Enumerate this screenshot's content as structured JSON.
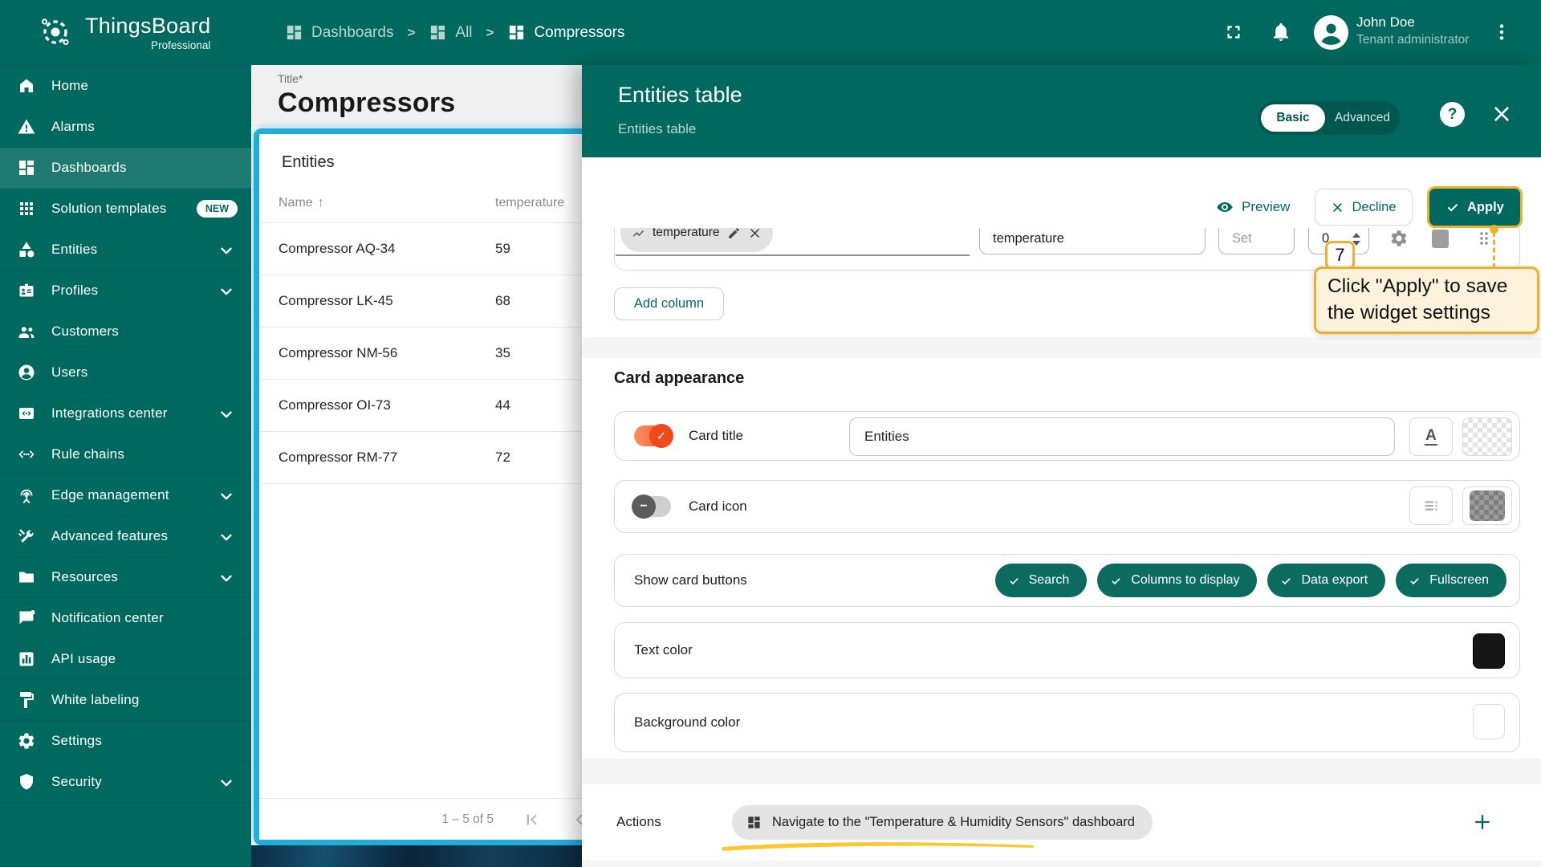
{
  "colors": {
    "accent": "#00695f",
    "selection_border": "#1faedc",
    "toggle_on": "#ee4a1c",
    "tour_accent": "#f0b02c",
    "tour_bg": "#fdf3dd",
    "pill_bg": "#0b6b5f"
  },
  "brand": {
    "name": "ThingsBoard",
    "edition": "Professional"
  },
  "topbar": {
    "breadcrumbs": [
      {
        "label": "Dashboards"
      },
      {
        "label": "All"
      },
      {
        "label": "Compressors"
      }
    ],
    "user": {
      "name": "John Doe",
      "role": "Tenant administrator"
    }
  },
  "sidebar": {
    "items": [
      {
        "label": "Home",
        "icon": "home"
      },
      {
        "label": "Alarms",
        "icon": "alarm"
      },
      {
        "label": "Dashboards",
        "icon": "dashboards",
        "active": true
      },
      {
        "label": "Solution templates",
        "icon": "apps",
        "badge": "NEW"
      },
      {
        "label": "Entities",
        "icon": "category",
        "expandable": true
      },
      {
        "label": "Profiles",
        "icon": "badge",
        "expandable": true
      },
      {
        "label": "Customers",
        "icon": "people"
      },
      {
        "label": "Users",
        "icon": "person"
      },
      {
        "label": "Integrations center",
        "icon": "integration",
        "expandable": true
      },
      {
        "label": "Rule chains",
        "icon": "ethernet"
      },
      {
        "label": "Edge management",
        "icon": "antenna",
        "expandable": true
      },
      {
        "label": "Advanced features",
        "icon": "tools",
        "expandable": true
      },
      {
        "label": "Resources",
        "icon": "folder",
        "expandable": true
      },
      {
        "label": "Notification center",
        "icon": "chat"
      },
      {
        "label": "API usage",
        "icon": "chart"
      },
      {
        "label": "White labeling",
        "icon": "paint"
      },
      {
        "label": "Settings",
        "icon": "gear"
      },
      {
        "label": "Security",
        "icon": "shield",
        "expandable": true
      }
    ]
  },
  "dashboard": {
    "title_label": "Title*",
    "title": "Compressors",
    "widget": {
      "title": "Entities",
      "columns": [
        {
          "label": "Name",
          "sort": "asc"
        },
        {
          "label": "temperature"
        }
      ],
      "rows": [
        {
          "name": "Compressor AQ-34",
          "temperature": "59"
        },
        {
          "name": "Compressor LK-45",
          "temperature": "68"
        },
        {
          "name": "Compressor NM-56",
          "temperature": "35"
        },
        {
          "name": "Compressor OI-73",
          "temperature": "44"
        },
        {
          "name": "Compressor RM-77",
          "temperature": "72"
        }
      ],
      "pagination": "1 – 5 of 5"
    }
  },
  "panel": {
    "title": "Entities table",
    "subtitle": "Entities table",
    "mode": {
      "basic": "Basic",
      "advanced": "Advanced",
      "selected": "Basic"
    },
    "actions_bar": {
      "preview": "Preview",
      "decline": "Decline",
      "apply": "Apply"
    },
    "data_key": {
      "chip": "temperature",
      "label": "temperature",
      "set_placeholder": "Set",
      "width_value": "0"
    },
    "add_column": "Add column",
    "card_appearance": {
      "heading": "Card appearance",
      "card_title_label": "Card title",
      "card_title_value": "Entities",
      "card_icon_label": "Card icon",
      "show_card_buttons_label": "Show card buttons",
      "card_buttons": [
        "Search",
        "Columns to display",
        "Data export",
        "Fullscreen"
      ],
      "text_color_label": "Text color",
      "background_color_label": "Background color"
    },
    "actions": {
      "label": "Actions",
      "item": "Navigate to the \"Temperature & Humidity Sensors\" dashboard"
    }
  },
  "tour": {
    "step": "7",
    "text": "Click \"Apply\" to save the widget settings"
  }
}
